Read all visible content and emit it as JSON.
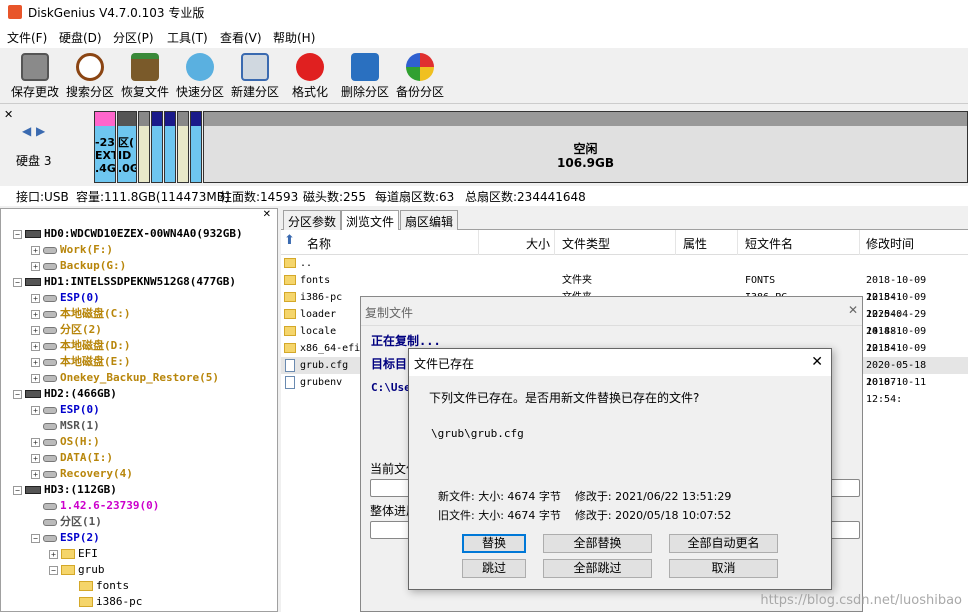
{
  "app": {
    "title": "DiskGenius V4.7.0.103 专业版"
  },
  "menu": [
    "文件(F)",
    "硬盘(D)",
    "分区(P)",
    "工具(T)",
    "查看(V)",
    "帮助(H)"
  ],
  "toolbar": [
    {
      "label": "保存更改",
      "icon": "save-icon"
    },
    {
      "label": "搜索分区",
      "icon": "magnifier-icon"
    },
    {
      "label": "恢复文件",
      "icon": "recover-icon"
    },
    {
      "label": "快速分区",
      "icon": "quick-partition-icon"
    },
    {
      "label": "新建分区",
      "icon": "new-partition-icon"
    },
    {
      "label": "格式化",
      "icon": "format-icon"
    },
    {
      "label": "删除分区",
      "icon": "delete-icon"
    },
    {
      "label": "备份分区",
      "icon": "backup-icon"
    }
  ],
  "diskbar": {
    "disk_label": "硬盘 3",
    "seg1": [
      "-23",
      "EXT3",
      ".4G"
    ],
    "seg2": [
      "区(",
      "ID",
      ".0G"
    ],
    "free_label": "空闲",
    "free_size": "106.9GB"
  },
  "info": {
    "interface": "接口:USB",
    "capacity": "容量:111.8GB(114473MB)",
    "cylinders": "柱面数:14593",
    "heads": "磁头数:255",
    "sectors": "每道扇区数:63",
    "total_sectors": "总扇区数:234441648"
  },
  "tree": [
    {
      "indent": 0,
      "kind": "disk",
      "label": "HD0:WDCWD10EZEX-00WN4A0(932GB)",
      "color": "#000000",
      "exp": "−"
    },
    {
      "indent": 1,
      "kind": "part",
      "label": "Work(F:)",
      "color": "#b8860b",
      "exp": "+"
    },
    {
      "indent": 1,
      "kind": "part",
      "label": "Backup(G:)",
      "color": "#b8860b",
      "exp": "+"
    },
    {
      "indent": 0,
      "kind": "disk",
      "label": "HD1:INTELSSDPEKNW512G8(477GB)",
      "color": "#000000",
      "exp": "−"
    },
    {
      "indent": 1,
      "kind": "part",
      "label": "ESP(0)",
      "color": "#0000cc",
      "exp": "+"
    },
    {
      "indent": 1,
      "kind": "part",
      "label": "本地磁盘(C:)",
      "color": "#b8860b",
      "exp": "+"
    },
    {
      "indent": 1,
      "kind": "part",
      "label": "分区(2)",
      "color": "#b8860b",
      "exp": "+"
    },
    {
      "indent": 1,
      "kind": "part",
      "label": "本地磁盘(D:)",
      "color": "#b8860b",
      "exp": "+"
    },
    {
      "indent": 1,
      "kind": "part",
      "label": "本地磁盘(E:)",
      "color": "#b8860b",
      "exp": "+"
    },
    {
      "indent": 1,
      "kind": "part",
      "label": "Onekey_Backup_Restore(5)",
      "color": "#b8860b",
      "exp": "+"
    },
    {
      "indent": 0,
      "kind": "disk",
      "label": "HD2:(466GB)",
      "color": "#000000",
      "exp": "−"
    },
    {
      "indent": 1,
      "kind": "part",
      "label": "ESP(0)",
      "color": "#0000cc",
      "exp": "+"
    },
    {
      "indent": 1,
      "kind": "part",
      "label": "MSR(1)",
      "color": "#555555",
      "exp": ""
    },
    {
      "indent": 1,
      "kind": "part",
      "label": "OS(H:)",
      "color": "#b8860b",
      "exp": "+"
    },
    {
      "indent": 1,
      "kind": "part",
      "label": "DATA(I:)",
      "color": "#b8860b",
      "exp": "+"
    },
    {
      "indent": 1,
      "kind": "part",
      "label": "Recovery(4)",
      "color": "#b8860b",
      "exp": "+"
    },
    {
      "indent": 0,
      "kind": "disk",
      "label": "HD3:(112GB)",
      "color": "#000000",
      "exp": "−"
    },
    {
      "indent": 1,
      "kind": "part",
      "label": "1.42.6-23739(0)",
      "color": "#cc00cc",
      "exp": ""
    },
    {
      "indent": 1,
      "kind": "part",
      "label": "分区(1)",
      "color": "#555555",
      "exp": ""
    },
    {
      "indent": 1,
      "kind": "part",
      "label": "ESP(2)",
      "color": "#0000cc",
      "exp": "−"
    },
    {
      "indent": 2,
      "kind": "folder",
      "label": "EFI",
      "color": "#000000",
      "exp": "+"
    },
    {
      "indent": 2,
      "kind": "folder",
      "label": "grub",
      "color": "#000000",
      "exp": "−"
    },
    {
      "indent": 3,
      "kind": "folder",
      "label": "fonts",
      "color": "#000000",
      "exp": ""
    },
    {
      "indent": 3,
      "kind": "folder",
      "label": "i386-pc",
      "color": "#000000",
      "exp": ""
    }
  ],
  "tabs": [
    "分区参数",
    "浏览文件",
    "扇区编辑"
  ],
  "columns": [
    "名称",
    "大小",
    "文件类型",
    "属性",
    "短文件名",
    "修改时间"
  ],
  "files": [
    {
      "name": "..",
      "type": "",
      "short": "",
      "time": "",
      "icon": "folder"
    },
    {
      "name": "fonts",
      "type": "文件夹",
      "short": "FONTS",
      "time": "2018-10-09 12:54:",
      "icon": "folder"
    },
    {
      "name": "i386-pc",
      "type": "文件夹",
      "short": "I386-PC",
      "time": "2018-10-09 12:54:",
      "icon": "folder"
    },
    {
      "name": "loader",
      "type": "",
      "short": "",
      "time": "2020-04-29 14:48:",
      "icon": "folder"
    },
    {
      "name": "locale",
      "type": "",
      "short": "",
      "time": "2018-10-09 12:54:",
      "icon": "folder"
    },
    {
      "name": "x86_64-efi",
      "type": "",
      "short": "",
      "time": "2018-10-09 12:54:",
      "icon": "folder"
    },
    {
      "name": "grub.cfg",
      "type": "",
      "short": "",
      "time": "2020-05-18 10:07:",
      "icon": "file"
    },
    {
      "name": "grubenv",
      "type": "",
      "short": "",
      "time": "2018-10-11 12:54:",
      "icon": "file"
    }
  ],
  "copy_dialog": {
    "title": "复制文件",
    "copying": "正在复制...",
    "target_label": "目标目",
    "target_path": "C:\\Use",
    "current_label": "当前文件",
    "overall_label": "整体进展"
  },
  "exists_dialog": {
    "title": "文件已存在",
    "question": "下列文件已存在。是否用新文件替换已存在的文件?",
    "path": "\\grub\\grub.cfg",
    "new_file": "新文件: 大小: 4674 字节    修改于: 2021/06/22 13:51:29",
    "old_file": "旧文件: 大小: 4674 字节    修改于: 2020/05/18 10:07:52",
    "buttons": [
      "替换",
      "全部替换",
      "全部自动更名",
      "跳过",
      "全部跳过",
      "取消"
    ]
  },
  "watermark": "https://blog.csdn.net/luoshibao"
}
